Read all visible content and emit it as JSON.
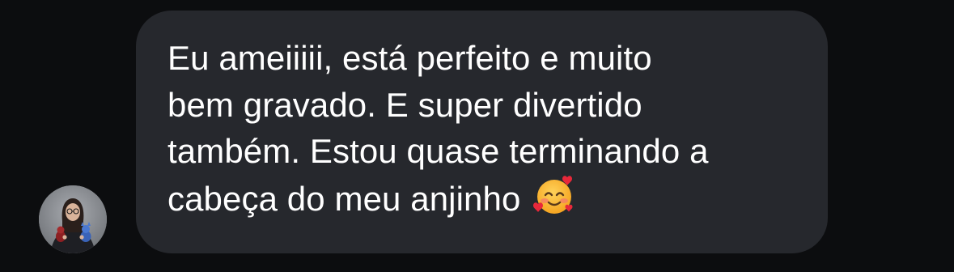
{
  "message": {
    "lines": [
      "Eu ameiiiii, está perfeito e muito",
      "bem gravado. E super divertido",
      "também. Estou quase terminando a",
      "cabeça do meu anjinho"
    ],
    "emoji": "smiling-face-with-hearts-icon"
  },
  "sender": {
    "avatar": "avatar"
  },
  "colors": {
    "background": "#0c0d0f",
    "bubble": "#26282d",
    "text": "#ffffff"
  }
}
